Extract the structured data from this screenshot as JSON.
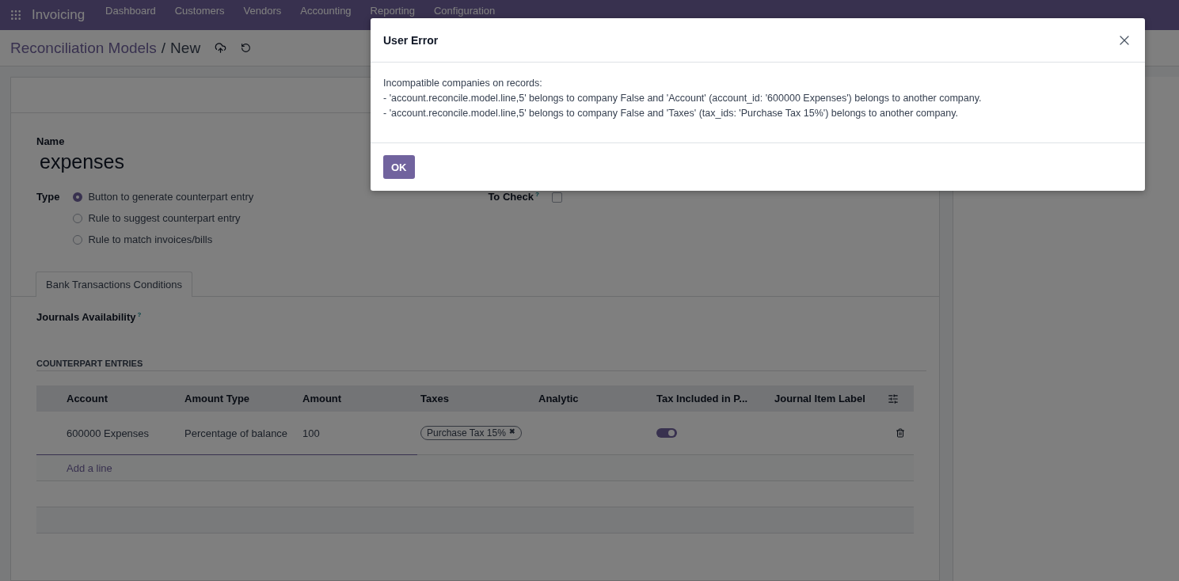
{
  "navbar": {
    "app_name": "Invoicing",
    "menu": [
      "Dashboard",
      "Customers",
      "Vendors",
      "Accounting",
      "Reporting",
      "Configuration"
    ]
  },
  "breadcrumb": {
    "parent": "Reconciliation Models",
    "separator": "/",
    "current": "New"
  },
  "form": {
    "name_label": "Name",
    "name_value": "expenses",
    "type_label": "Type",
    "type_options": [
      {
        "label": "Button to generate counterpart entry",
        "selected": true
      },
      {
        "label": "Rule to suggest counterpart entry",
        "selected": false
      },
      {
        "label": "Rule to match invoices/bills",
        "selected": false
      }
    ],
    "to_check": {
      "label": "To Check",
      "help": "?",
      "checked": false
    },
    "tabs": [
      {
        "label": "Bank Transactions Conditions",
        "selected": true
      }
    ],
    "journals": {
      "label": "Journals Availability",
      "help": "?"
    },
    "section_title": "COUNTERPART ENTRIES",
    "table": {
      "columns": [
        "Account",
        "Amount Type",
        "Amount",
        "Taxes",
        "Analytic",
        "Tax Included in P...",
        "Journal Item Label"
      ],
      "rows": [
        {
          "account": "600000 Expenses",
          "amount_type": "Percentage of balance",
          "amount": "100",
          "taxes": [
            {
              "label": "Purchase Tax 15%",
              "remove": "✖"
            }
          ],
          "tax_included": true
        }
      ],
      "add_line": "Add a line"
    }
  },
  "dialog": {
    "title": "User Error",
    "message": [
      "Incompatible companies on records:",
      "- 'account.reconcile.model.line,5' belongs to company False and 'Account' (account_id: '600000 Expenses') belongs to another company.",
      "- 'account.reconcile.model.line,5' belongs to company False and 'Taxes' (tax_ids: 'Purchase Tax 15%') belongs to another company."
    ],
    "ok_button": "OK"
  }
}
